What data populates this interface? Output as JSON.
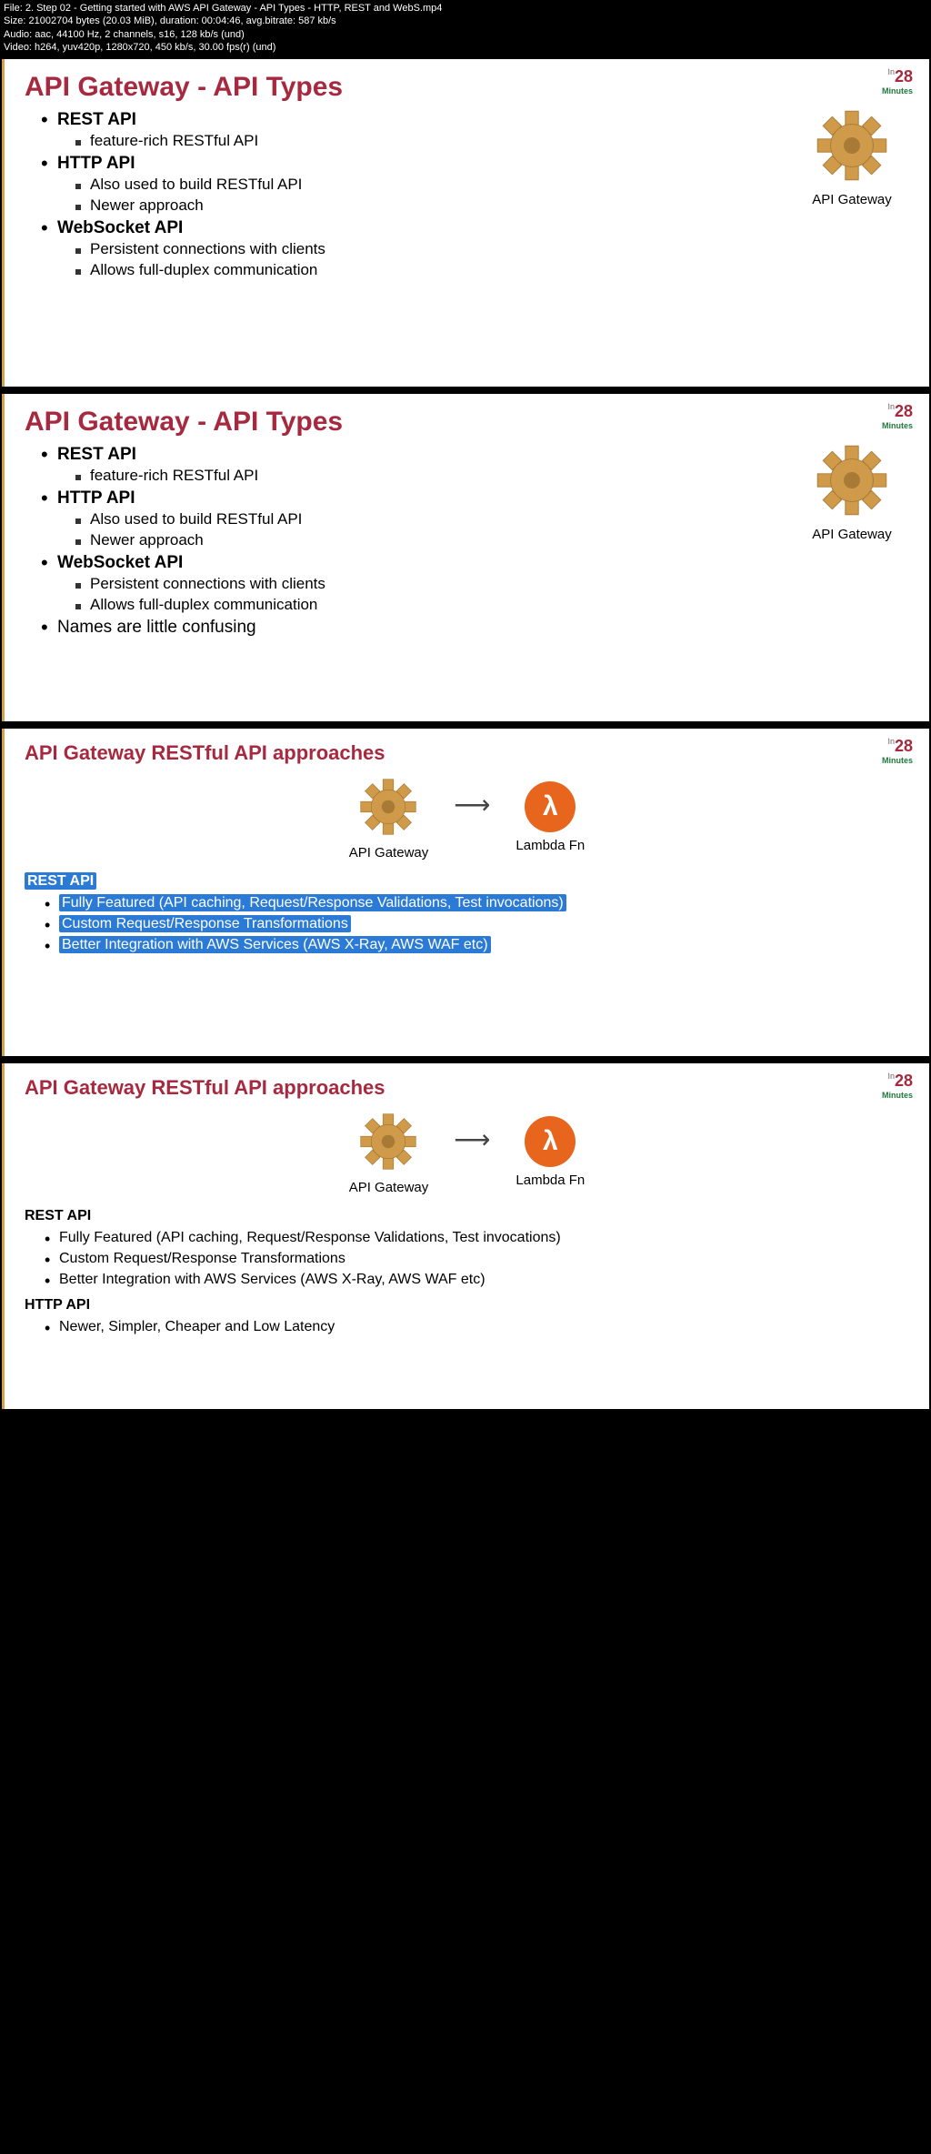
{
  "metadata": {
    "file": "File: 2. Step 02 - Getting started with AWS API Gateway - API Types - HTTP, REST and WebS.mp4",
    "size": "Size: 21002704 bytes (20.03 MiB), duration: 00:04:46, avg.bitrate: 587 kb/s",
    "audio": "Audio: aac, 44100 Hz, 2 channels, s16, 128 kb/s (und)",
    "video": "Video: h264, yuv420p, 1280x720, 450 kb/s, 30.00 fps(r) (und)"
  },
  "logo": {
    "in": "In",
    "num": "28",
    "min": "Minutes"
  },
  "apigw_label": "API Gateway",
  "slide1": {
    "title": "API Gateway - API Types",
    "rest": "REST API",
    "rest_sub1": "feature-rich RESTful API",
    "http": "HTTP API",
    "http_sub1": "Also used to build RESTful API",
    "http_sub2": "Newer approach",
    "ws": "WebSocket API",
    "ws_sub1": "Persistent connections with clients",
    "ws_sub2": "Allows full-duplex communication"
  },
  "slide2": {
    "title": "API Gateway - API Types",
    "rest": "REST API",
    "rest_sub1": "feature-rich RESTful API",
    "http": "HTTP API",
    "http_sub1": "Also used to build RESTful API",
    "http_sub2": "Newer approach",
    "ws": "WebSocket API",
    "ws_sub1": "Persistent connections with clients",
    "ws_sub2": "Allows full-duplex communication",
    "confusing": "Names are little confusing"
  },
  "slide3": {
    "title": "API Gateway RESTful API approaches",
    "apigw_label": "API Gateway",
    "lambda_label": "Lambda Fn",
    "section": "REST API",
    "b1": "Fully Featured (API caching, Request/Response Validations, Test invocations)",
    "b2": "Custom Request/Response Transformations",
    "b3": "Better Integration with AWS Services (AWS X-Ray, AWS WAF etc)"
  },
  "slide4": {
    "title": "API Gateway RESTful API approaches",
    "apigw_label": "API Gateway",
    "lambda_label": "Lambda Fn",
    "rest_hdr": "REST API",
    "r1": "Fully Featured (API caching, Request/Response Validations, Test invocations)",
    "r2": "Custom Request/Response Transformations",
    "r3": "Better Integration with AWS Services (AWS X-Ray, AWS WAF etc)",
    "http_hdr": "HTTP API",
    "h1": "Newer, Simpler, Cheaper and Low Latency"
  }
}
